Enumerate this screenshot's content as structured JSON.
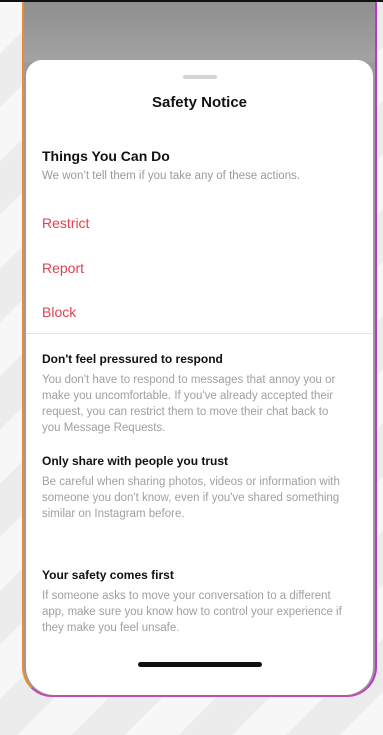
{
  "sheet": {
    "title": "Safety Notice",
    "section_title": "Things You Can Do",
    "section_subtitle": "We won’t tell them if you take any of these actions.",
    "actions": [
      "Restrict",
      "Report",
      "Block"
    ]
  },
  "tips": [
    {
      "title": "Don't feel pressured to respond",
      "body": "You don't have to respond to messages that annoy you or make you uncomfortable. If you've already accepted their request, you can restrict them to move their chat back to you Message Requests."
    },
    {
      "title": "Only share with people you trust",
      "body": "Be careful when sharing photos, videos or information with someone you don't know, even if you've shared something similar on Instagram before."
    },
    {
      "title": "Your safety comes first",
      "body": "If someone asks to move your conversation to a different app, make sure you know how to control your experience if they make you feel unsafe."
    }
  ],
  "colors": {
    "action_red": "#e0414f",
    "frame_orange": "#f08a2e",
    "frame_purple": "#b83acb"
  }
}
